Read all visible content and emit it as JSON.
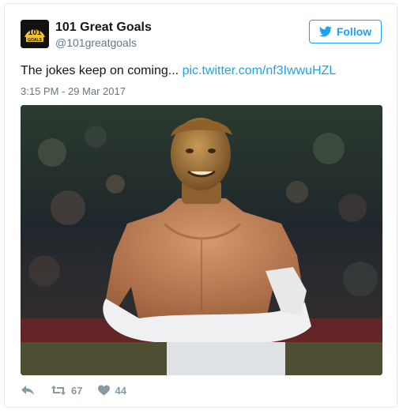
{
  "account": {
    "name": "101 Great Goals",
    "handle": "@101greatgoals",
    "avatar_icon": "101-great-goals-logo"
  },
  "follow": {
    "label": "Follow",
    "color": "#1da1f2",
    "icon": "twitter-bird-icon"
  },
  "tweet": {
    "text": "The jokes keep on coming...",
    "link_text": "pic.twitter.com/nf3IwwuHZL",
    "timestamp": "3:15 PM - 29 Mar 2017"
  },
  "media": {
    "description": "edited photo of shirtless footballer with bronze statue head"
  },
  "actions": {
    "reply_icon": "reply-icon",
    "retweet_icon": "retweet-icon",
    "retweet_count": "67",
    "like_icon": "heart-icon",
    "like_count": "44"
  },
  "colors": {
    "text": "#14171a",
    "secondary": "#657786",
    "link": "#1da1f2",
    "action": "#8899a6",
    "border": "#e1e8ed"
  }
}
